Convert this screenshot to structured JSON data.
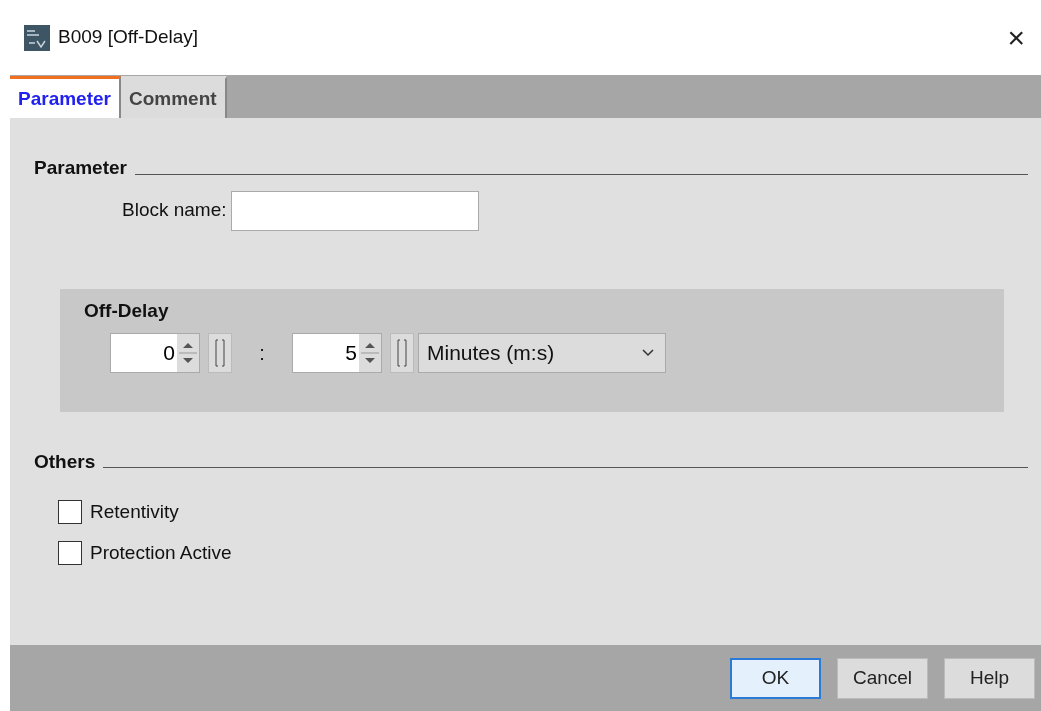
{
  "window": {
    "title": "B009 [Off-Delay]",
    "close": "×"
  },
  "tabs": [
    {
      "label": "Parameter",
      "selected": true
    },
    {
      "label": "Comment",
      "selected": false
    }
  ],
  "parameter": {
    "heading": "Parameter",
    "block_name": {
      "label": "Block name:"
    }
  },
  "off_delay": {
    "heading": "Off-Delay",
    "first": {
      "value": "0"
    },
    "separator": ":",
    "second": {
      "value": "5"
    },
    "unit": "Minutes (m:s)"
  },
  "others": {
    "heading": "Others",
    "checkboxes": [
      {
        "label": "Retentivity",
        "checked": false
      },
      {
        "label": "Protection Active",
        "checked": false
      }
    ]
  },
  "buttons": [
    {
      "label": "OK",
      "default": true
    },
    {
      "label": "Cancel",
      "default": false
    },
    {
      "label": "Help",
      "default": false
    }
  ]
}
